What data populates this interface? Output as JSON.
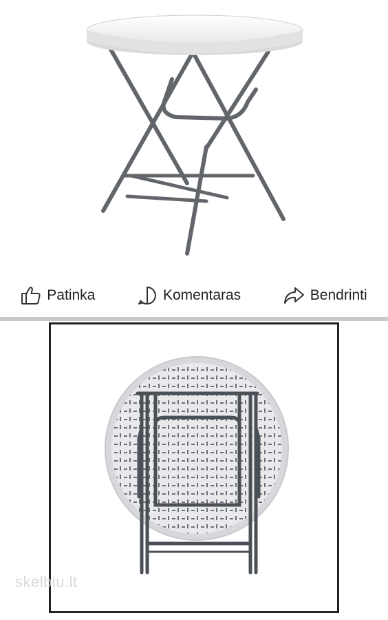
{
  "actions": {
    "like_label": "Patinka",
    "comment_label": "Komentaras",
    "share_label": "Bendrinti"
  },
  "watermark": {
    "text": "skelbiu.lt"
  },
  "colors": {
    "divider": "#c9cacc",
    "frame_border": "#222222",
    "table_top": "#f4f4f4",
    "table_frame": "#5d6166"
  },
  "icons": {
    "like": "thumbs-up-icon",
    "comment": "speech-bubble-icon",
    "share": "share-arrow-icon"
  }
}
